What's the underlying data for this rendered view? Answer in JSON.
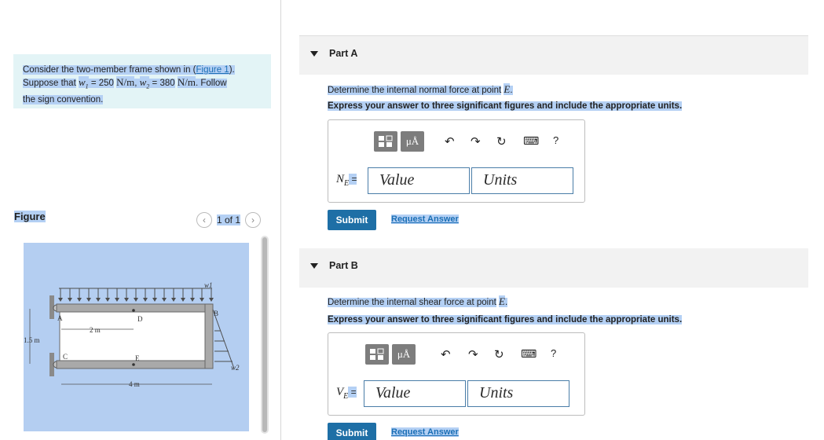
{
  "problem": {
    "text_1": "Consider the two-member frame shown in (",
    "figure_link": "Figure 1",
    "text_2": ").",
    "text_3": "Suppose that",
    "w1_sym": "w",
    "w1_sub": "1",
    "eq": " = ",
    "w1_value": "250",
    "unit": "N/m",
    "w2_sym": "w",
    "w2_sub": "2",
    "w2_value": "380",
    "text_4": ". Follow",
    "text_5": "the sign convention."
  },
  "figure_panel": {
    "label": "Figure",
    "pager": "1 of 1",
    "prev_symbol": "‹",
    "next_symbol": "›",
    "diagram": {
      "w1": "w1",
      "w2": "w2",
      "A": "A",
      "B": "B",
      "C": "C",
      "D": "D",
      "E": "E",
      "dim_2m": "2 m",
      "dim_4m": "4 m",
      "dim_15m": "1.5 m"
    }
  },
  "parts": [
    {
      "title": "Part A",
      "question": "Determine the internal normal force at point",
      "point": "E",
      "instruction": "Express your answer to three significant figures and include the appropriate units.",
      "var": "N",
      "var_sub": "E",
      "eq": " =",
      "value_placeholder": "Value",
      "units_placeholder": "Units",
      "submit": "Submit",
      "request": "Request Answer"
    },
    {
      "title": "Part B",
      "question": "Determine the internal shear force at point",
      "point": "E",
      "instruction": "Express your answer to three significant figures and include the appropriate units.",
      "var": "V",
      "var_sub": "E",
      "eq": " =",
      "value_placeholder": "Value",
      "units_placeholder": "Units",
      "submit": "Submit",
      "request": "Request Answer"
    }
  ],
  "toolbar": {
    "mu_a": "μÅ",
    "undo": "↶",
    "redo": "↷",
    "reset": "↻",
    "keyboard": "⌨",
    "help": "?"
  },
  "colors": {
    "selection": "#b4d0f4",
    "problem_bg": "#e3f4f6",
    "submit_bg": "#1e6fa6",
    "link": "#1b6fb5"
  }
}
